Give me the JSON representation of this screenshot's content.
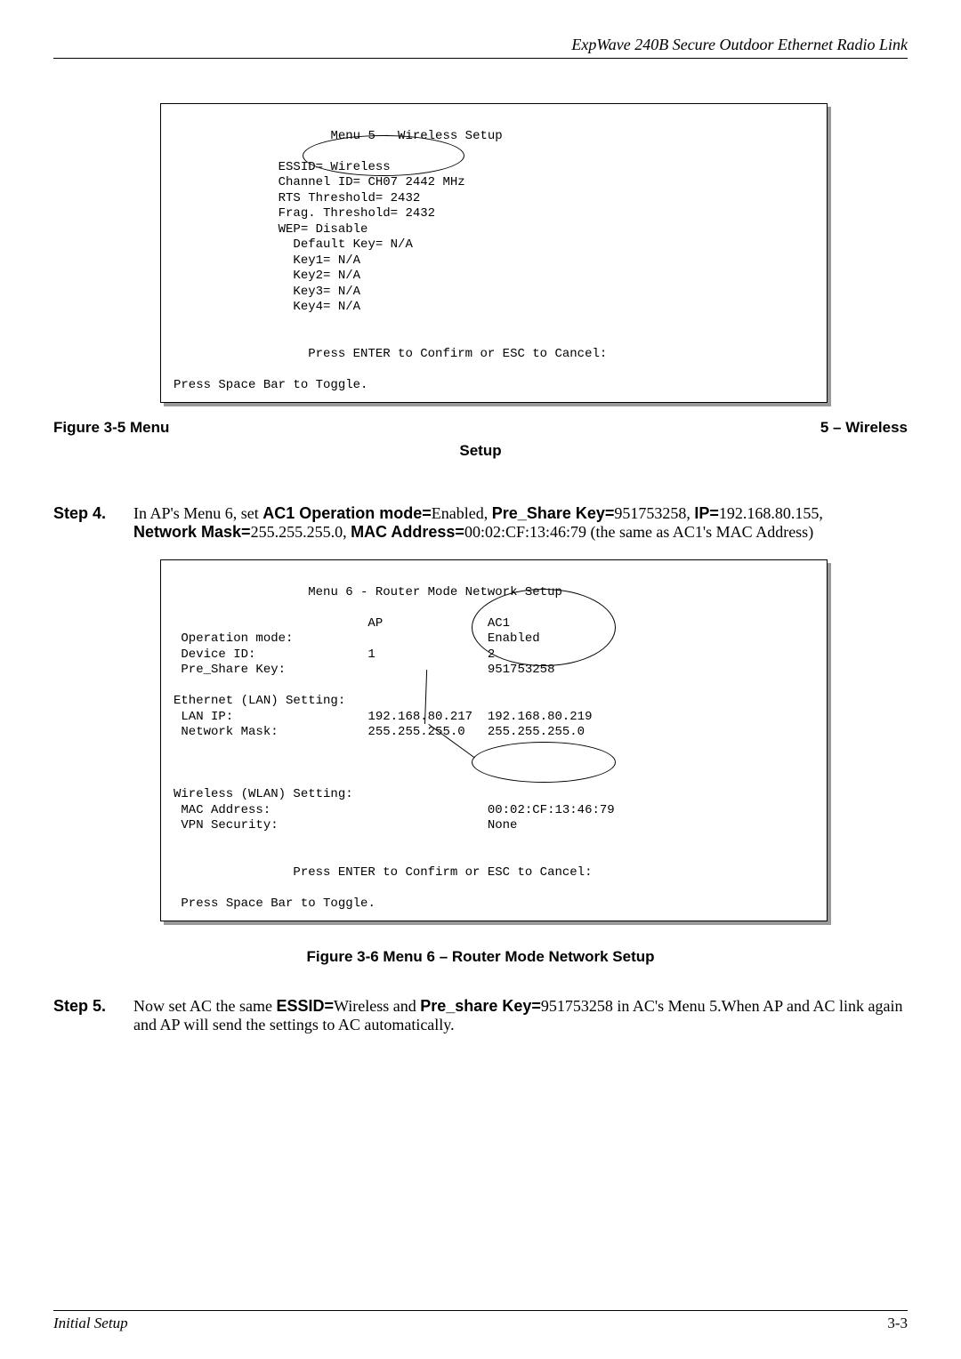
{
  "header": {
    "title": "ExpWave 240B Secure Outdoor Ethernet Radio Link"
  },
  "terminal1": {
    "title": "Menu 5 - Wireless Setup",
    "l1": "ESSID= Wireless",
    "l2": "Channel ID= CH07 2442 MHz",
    "l3": "RTS Threshold= 2432",
    "l4": "Frag. Threshold= 2432",
    "l5": "WEP= Disable",
    "l6": "  Default Key= N/A",
    "l7": "  Key1= N/A",
    "l8": "  Key2= N/A",
    "l9": "  Key3= N/A",
    "l10": "  Key4= N/A",
    "prompt": "Press ENTER to Confirm or ESC to Cancel:",
    "toggle": "Press Space Bar to Toggle."
  },
  "fig35": {
    "left": "Figure 3-5 Menu",
    "right": "5 – Wireless",
    "center": "Setup"
  },
  "step4": {
    "label": "Step 4.",
    "t1": "In AP's Menu 6, set ",
    "b1": "AC1 Operation mode=",
    "t2": "Enabled, ",
    "b2": "Pre_Share Key=",
    "t3": "951753258, ",
    "b3": "IP=",
    "t4": "192.168.80.155, ",
    "b4": "Network Mask=",
    "t5": "255.255.255.0, ",
    "b5": "MAC Address=",
    "t6": "00:02:CF:13:46:79 (the same as AC1's MAC Address)"
  },
  "terminal2": {
    "title": "Menu 6 - Router Mode Network Setup",
    "colhead": "                          AP              AC1",
    "r1": " Operation mode:                          Enabled",
    "r2": " Device ID:               1               2",
    "r3": " Pre_Share Key:                           951753258",
    "r4": "Ethernet (LAN) Setting:",
    "r5": " LAN IP:                  192.168.80.217  192.168.80.219",
    "r6": " Network Mask:            255.255.255.0   255.255.255.0",
    "r7": "Wireless (WLAN) Setting:",
    "r8": " MAC Address:                             00:02:CF:13:46:79",
    "r9": " VPN Security:                            None",
    "prompt": "Press ENTER to Confirm or ESC to Cancel:",
    "toggle": "Press Space Bar to Toggle."
  },
  "fig36": {
    "caption": "Figure 3-6 Menu 6 – Router Mode Network Setup"
  },
  "step5": {
    "label": "Step 5.",
    "t1": "Now set AC the same ",
    "b1": "ESSID=",
    "t2": "Wireless and ",
    "b2": "Pre_share Key=",
    "t3": "951753258 in AC's Menu 5.When AP and AC link again and AP will send the settings to AC automatically."
  },
  "footer": {
    "left": "Initial Setup",
    "right": "3-3"
  }
}
